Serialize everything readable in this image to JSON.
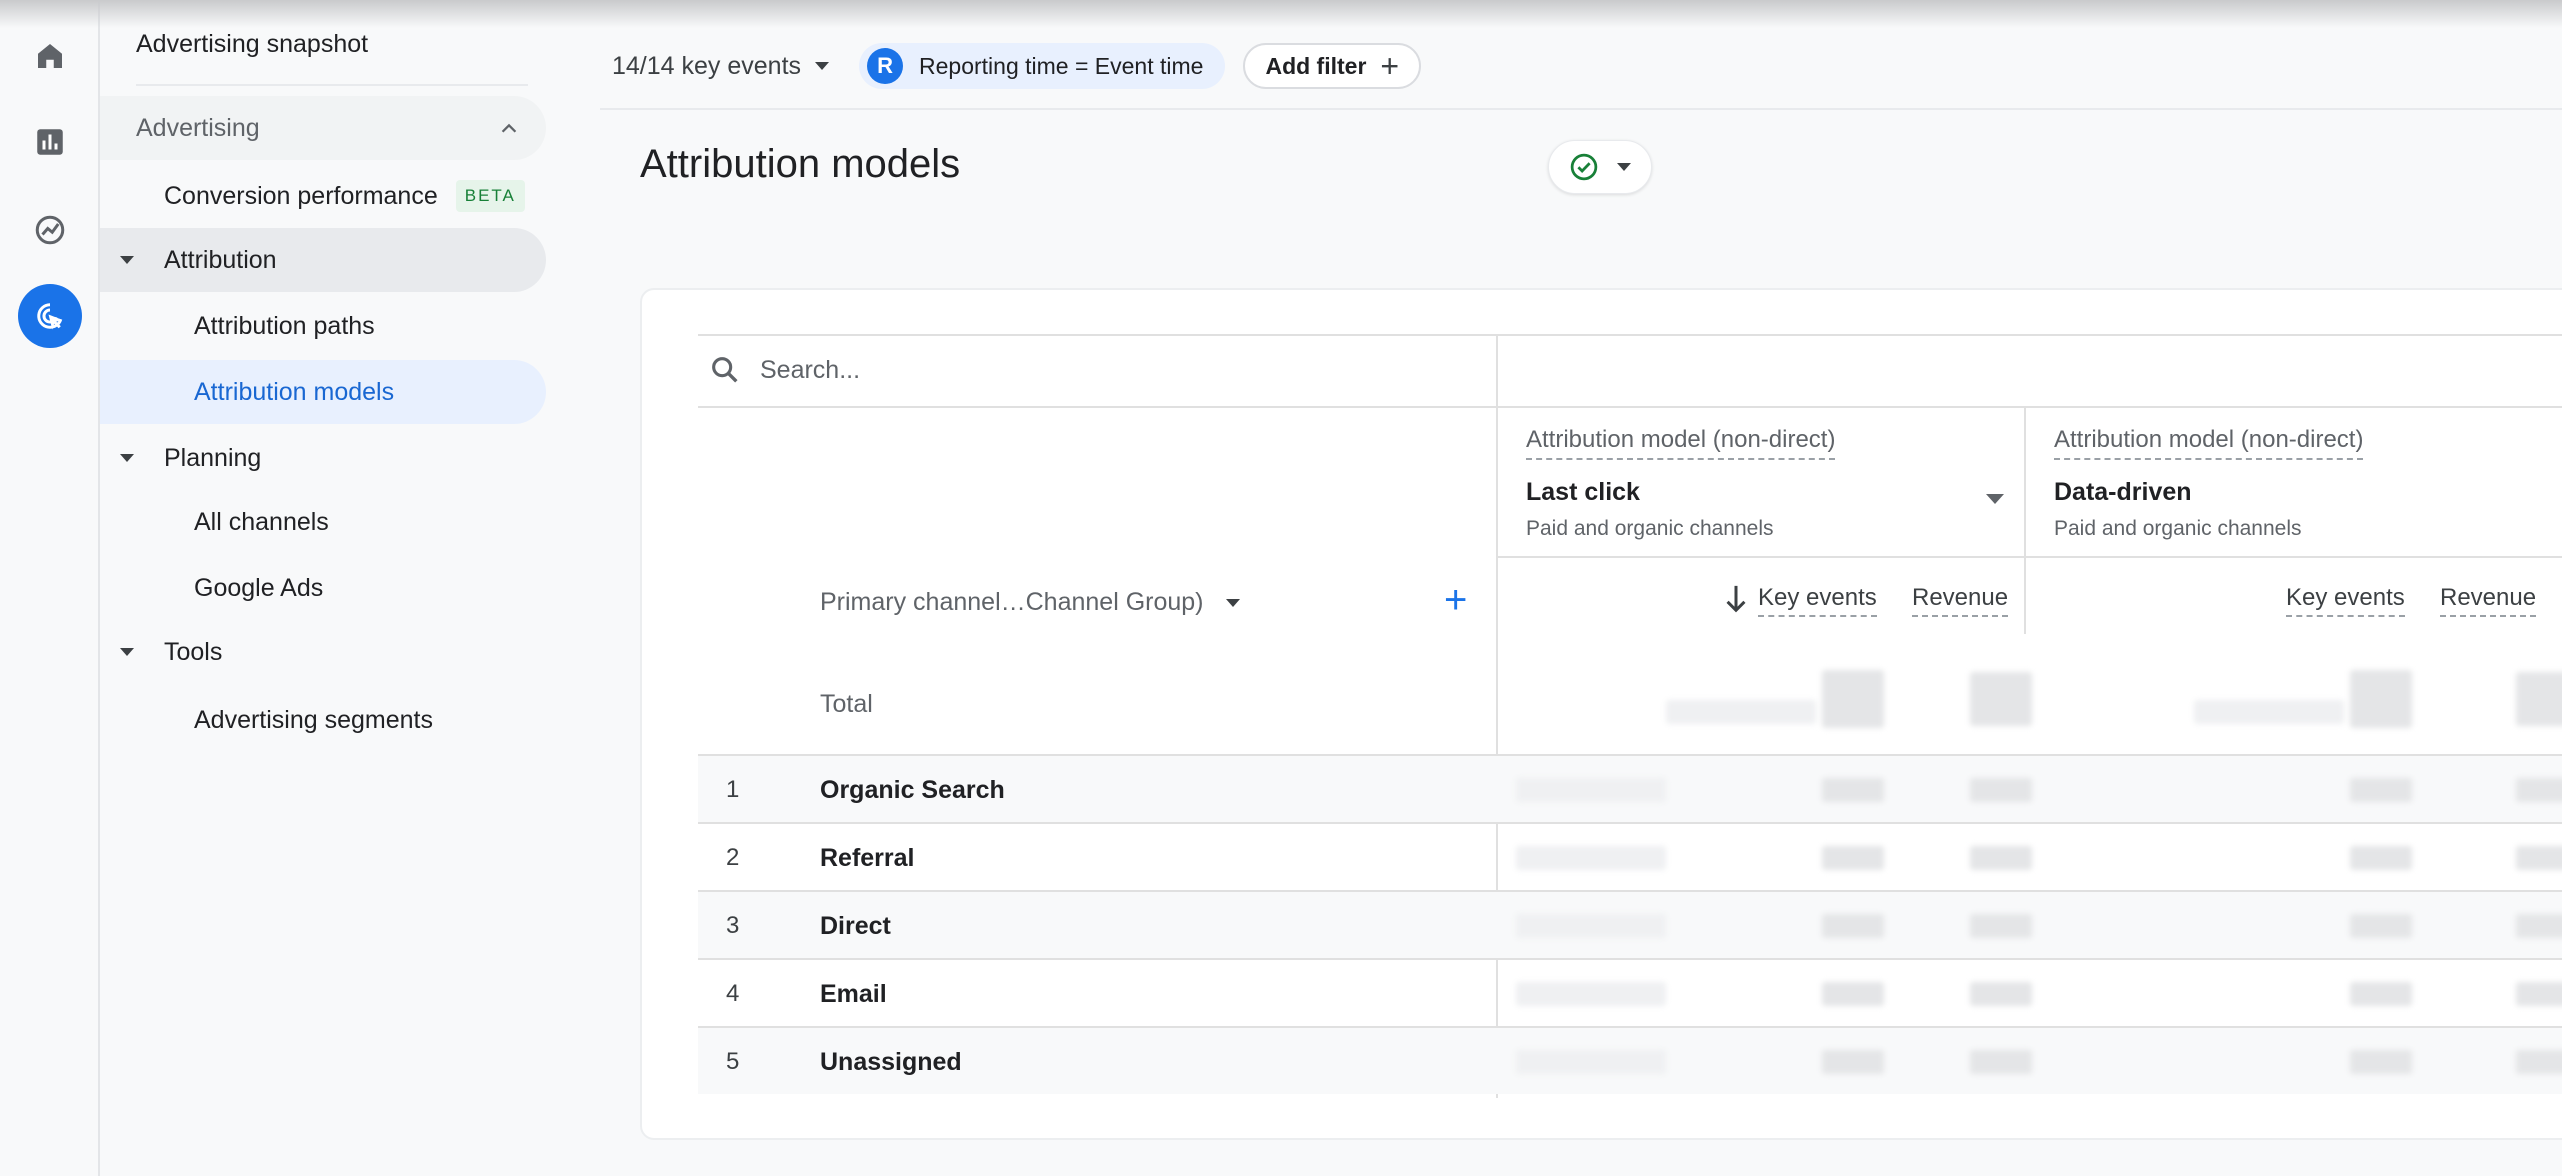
{
  "rail": {
    "items": [
      {
        "icon": "home-icon"
      },
      {
        "icon": "reports-icon"
      },
      {
        "icon": "explore-icon"
      },
      {
        "icon": "advertising-icon",
        "active": true
      }
    ]
  },
  "sidebar": {
    "snapshot": "Advertising snapshot",
    "section": "Advertising",
    "conversion": "Conversion performance",
    "beta": "BETA",
    "attribution": "Attribution",
    "attribution_paths": "Attribution paths",
    "attribution_models": "Attribution models",
    "planning": "Planning",
    "all_channels": "All channels",
    "google_ads": "Google Ads",
    "tools": "Tools",
    "segments": "Advertising segments"
  },
  "filters": {
    "key_events": "14/14 key events",
    "reporting_avatar": "R",
    "reporting": "Reporting time = Event time",
    "add_filter": "Add filter"
  },
  "page": {
    "title": "Attribution models"
  },
  "table": {
    "search_placeholder": "Search...",
    "dimension": "Primary channel…Channel Group)",
    "total_label": "Total",
    "models": [
      {
        "label": "Attribution model (non-direct)",
        "name": "Last click",
        "sub": "Paid and organic channels",
        "metrics": [
          "Key events",
          "Revenue"
        ]
      },
      {
        "label": "Attribution model (non-direct)",
        "name": "Data-driven",
        "sub": "Paid and organic channels",
        "metrics": [
          "Key events",
          "Revenue"
        ]
      }
    ],
    "rows": [
      {
        "num": "1",
        "label": "Organic Search"
      },
      {
        "num": "2",
        "label": "Referral"
      },
      {
        "num": "3",
        "label": "Direct"
      },
      {
        "num": "4",
        "label": "Email"
      },
      {
        "num": "5",
        "label": "Unassigned"
      }
    ]
  },
  "colors": {
    "accent": "#1a73e8",
    "active_bg": "#e8f0fe",
    "beta_green": "#188038"
  }
}
